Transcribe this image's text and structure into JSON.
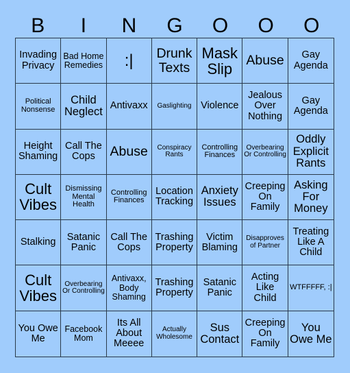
{
  "header": [
    "B",
    "I",
    "N",
    "G",
    "O",
    "O",
    "O"
  ],
  "cells": [
    "Invading Privacy",
    "Bad Home Remedies",
    ":|",
    "Drunk Texts",
    "Mask Slip",
    "Abuse",
    "Gay Agenda",
    "Political Nonsense",
    "Child Neglect",
    "Antivaxx",
    "Gaslighting",
    "Violence",
    "Jealous Over Nothing",
    "Gay Agenda",
    "Height Shaming",
    "Call The Cops",
    "Abuse",
    "Conspiracy Rants",
    "Controlling Finances",
    "Overbearing Or Controlling",
    "Oddly Explicit Rants",
    "Cult Vibes",
    "Dismissing Mental Health",
    "Controlling Finances",
    "Location Tracking",
    "Anxiety Issues",
    "Creeping On Family",
    "Asking For Money",
    "Stalking",
    "Satanic Panic",
    "Call The Cops",
    "Trashing Property",
    "Victim Blaming",
    "Disapproves of Partner",
    "Treating Like A Child",
    "Cult Vibes",
    "Overbearing Or Controlling",
    "Antivaxx, Body Shaming",
    "Trashing Property",
    "Satanic Panic",
    "Acting Like Child",
    "WTFFFFF, :|",
    "You Owe Me",
    "Facebook Mom",
    "Its All About Meeee",
    "Actually Wholesome",
    "Sus Contact",
    "Creeping On Family",
    "You Owe Me"
  ]
}
